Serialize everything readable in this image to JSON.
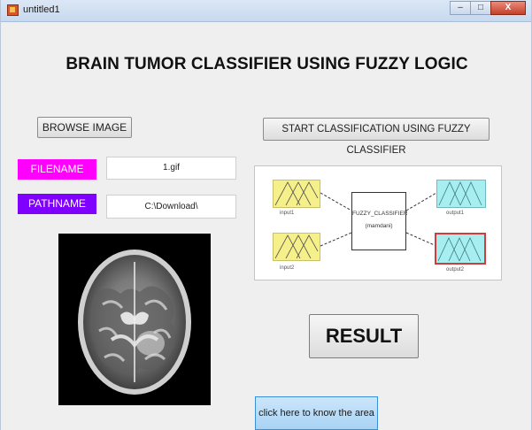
{
  "window": {
    "title": "untitled1",
    "controls": {
      "minimize": "–",
      "maximize": "□",
      "close": "X"
    }
  },
  "header": {
    "title": "BRAIN TUMOR CLASSIFIER USING FUZZY LOGIC"
  },
  "buttons": {
    "browse": "BROWSE IMAGE",
    "start": "START CLASSIFICATION USING FUZZY CLASSIFIER",
    "result": "RESULT",
    "area": "click here to know the area"
  },
  "labels": {
    "filename": "FILENAME",
    "pathname": "PATHNAME"
  },
  "fields": {
    "filename": "1.gif",
    "pathname": "C:\\Download\\"
  },
  "fis": {
    "inputs": [
      "input1",
      "input2"
    ],
    "outputs": [
      "output1",
      "output2"
    ],
    "system_name": "FUZZY_CLASSIFIER",
    "method": "(mamdani)"
  },
  "colors": {
    "filename_label": "#ff00ff",
    "pathname_label": "#8000ff",
    "input_mf": "#f6f08a",
    "output_mf": "#a7eef0",
    "selected_output_border": "#d23b3b",
    "area_button": "#a9d3f4"
  },
  "icons": {
    "app": "matlab-figure-icon",
    "mri": "brain-mri-scan-image"
  }
}
